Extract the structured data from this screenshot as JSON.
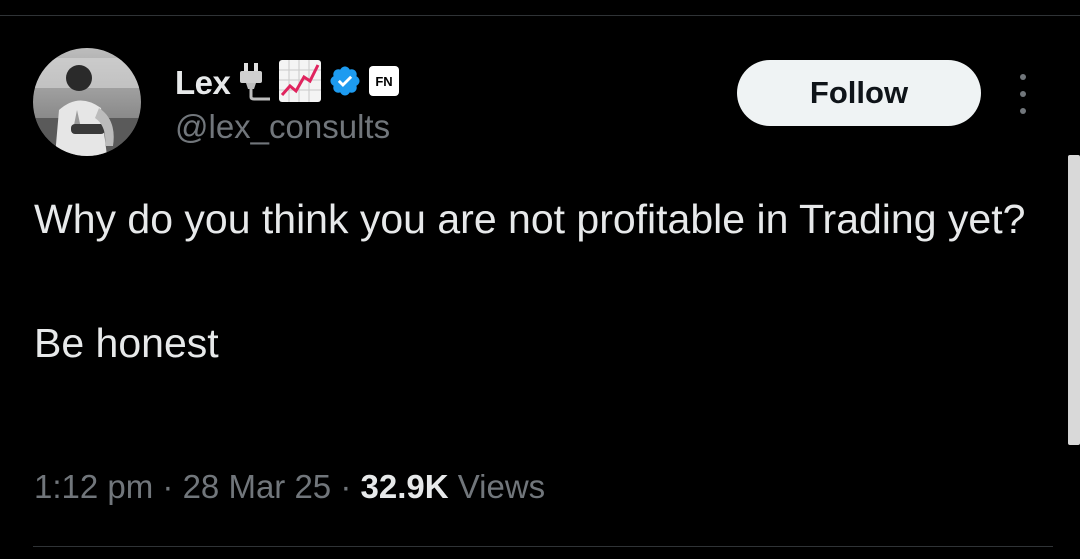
{
  "tweet": {
    "author": {
      "display_name": "Lex",
      "handle": "@lex_consults",
      "name_emojis": [
        "plug-emoji",
        "chart-increasing-emoji"
      ],
      "verified_badge": "verified-badge-icon",
      "affiliate_badge_text": "FN",
      "verified_color": "#1d9bf0"
    },
    "follow_label": "Follow",
    "more_icon": "more-vertical-icon",
    "text_lines": [
      "Why do you think you are not profitable in Trading yet?",
      "Be honest"
    ],
    "meta": {
      "time": "1:12 pm",
      "separator": " · ",
      "date": "28 Mar 25",
      "views_count": "32.9K",
      "views_label": "Views"
    }
  },
  "colors": {
    "background": "#000000",
    "text_primary": "#e7e9ea",
    "text_secondary": "#71767b",
    "follow_bg": "#eff3f4",
    "divider": "#2f3336"
  }
}
